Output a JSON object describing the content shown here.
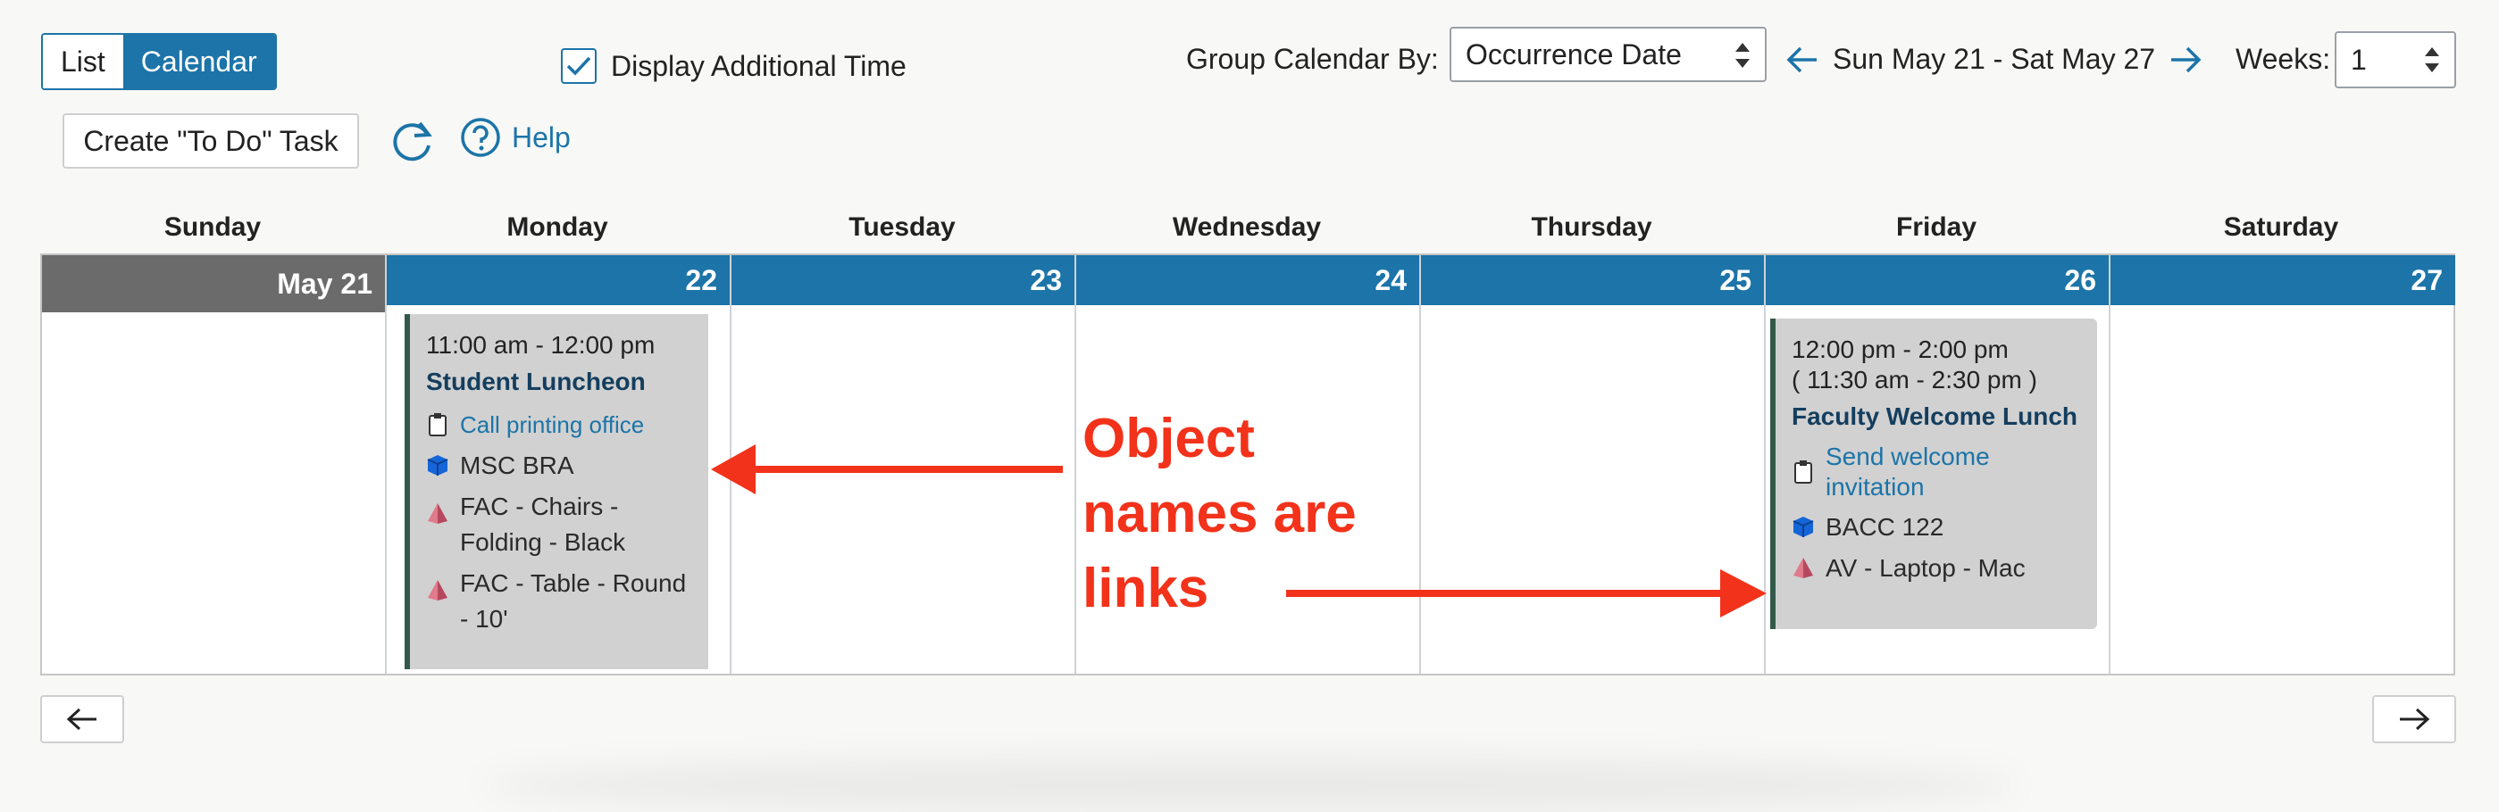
{
  "toolbar": {
    "view_list": "List",
    "view_calendar": "Calendar",
    "display_additional_time": "Display Additional Time",
    "group_by_label": "Group Calendar By:",
    "group_by_value": "Occurrence Date",
    "date_range": "Sun May 21 - Sat May 27",
    "weeks_label": "Weeks:",
    "weeks_value": "1",
    "create_todo": "Create \"To Do\" Task",
    "help": "Help"
  },
  "calendar": {
    "day_names": [
      "Sunday",
      "Monday",
      "Tuesday",
      "Wednesday",
      "Thursday",
      "Friday",
      "Saturday"
    ],
    "dates": [
      "May 21",
      "22",
      "23",
      "24",
      "25",
      "26",
      "27"
    ],
    "events": [
      {
        "time": "11:00 am - 12:00 pm",
        "title": "Student Luncheon",
        "task": "Call printing office",
        "location": "MSC BRA",
        "resources": [
          "FAC - Chairs - Folding - Black",
          "FAC - Table - Round - 10'"
        ]
      },
      {
        "time": "12:00 pm - 2:00 pm",
        "additional_time": "( 11:30 am - 2:30 pm )",
        "title": "Faculty Welcome Lunch",
        "task": "Send welcome invitation",
        "location": "BACC 122",
        "resources": [
          "AV - Laptop - Mac"
        ]
      }
    ]
  },
  "annotation": {
    "text_lines": [
      "Object",
      "names are",
      "links"
    ]
  },
  "colors": {
    "accent": "#1c74a8",
    "today_bar": "#6b6b6b",
    "event_bg": "#d1d1d1",
    "annotation": "#f2321a"
  }
}
